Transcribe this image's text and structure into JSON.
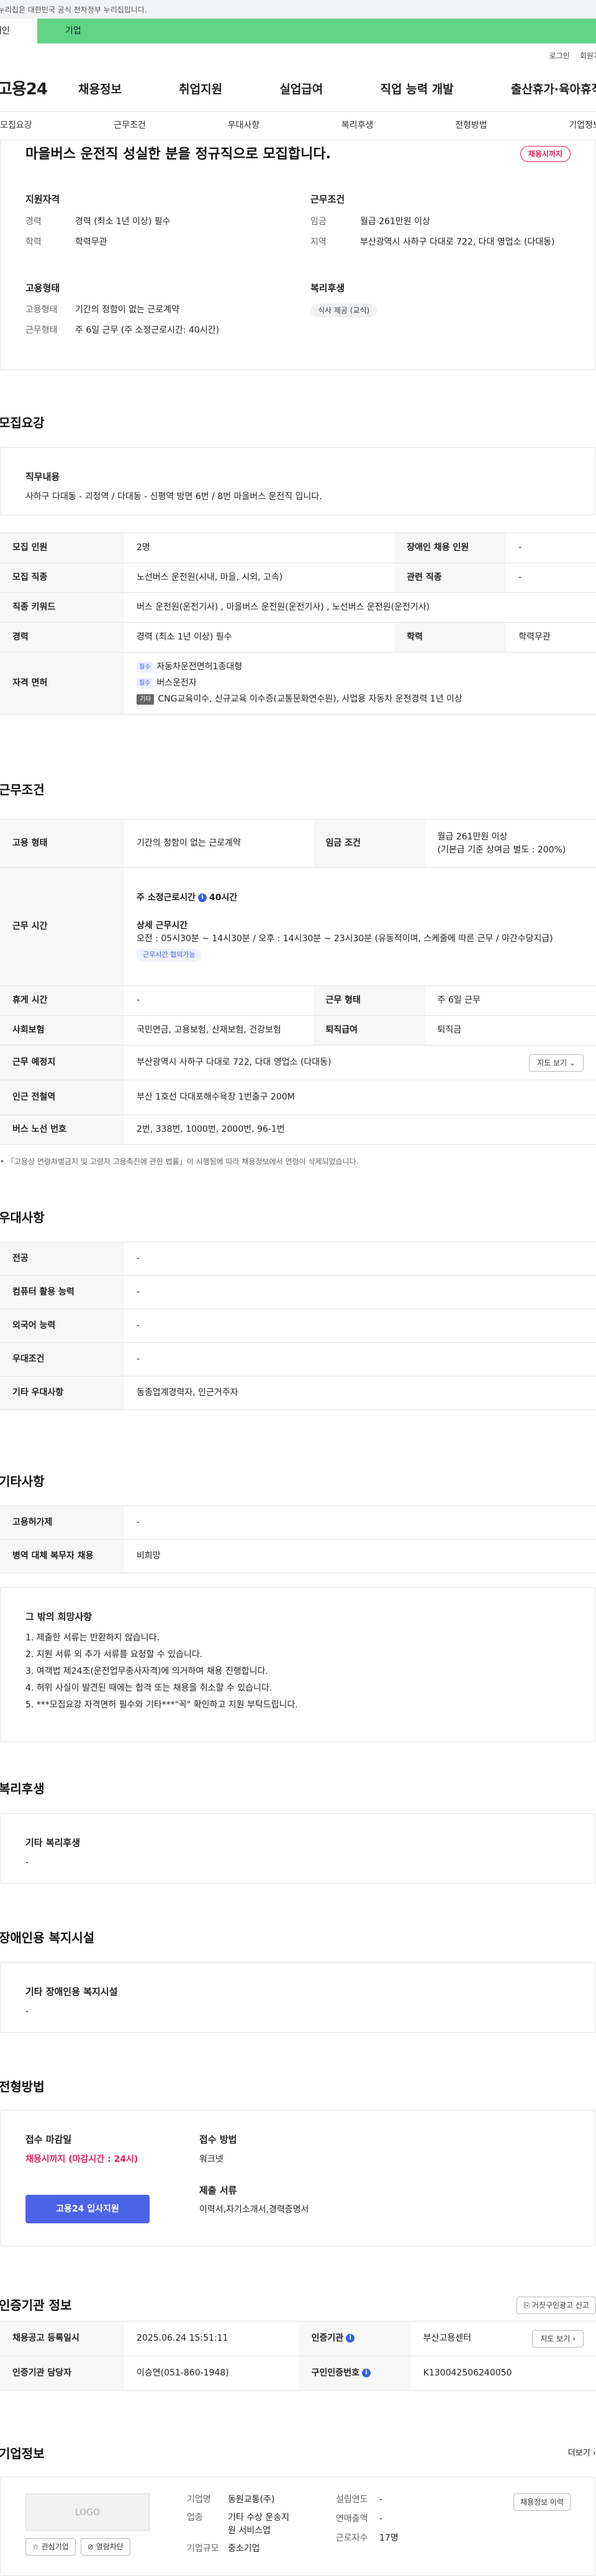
{
  "gov_banner": "이 누리집은 대한민국 공식 전자정부 누리집입니다.",
  "type_tabs": {
    "individual": "개인",
    "company": "기업"
  },
  "util": {
    "login": "로그인",
    "join": "회원가입"
  },
  "logo": "고용24",
  "gnb": [
    "채용정보",
    "취업지원",
    "실업급여",
    "직업 능력 개발",
    "출산휴가·육아휴직"
  ],
  "anchors": [
    "모집요강",
    "근무조건",
    "우대사항",
    "복리후생",
    "전형방법",
    "기업정보"
  ],
  "summary": {
    "title": "마을버스 운전직 성실한 분을 정규직으로 모집합니다.",
    "badge": "채용시까지",
    "qual_title": "지원자격",
    "career_k": "경력",
    "career_v": "경력 (최소 1년 이상) 필수",
    "edu_k": "학력",
    "edu_v": "학력무관",
    "cond_title": "근무조건",
    "wage_k": "임금",
    "wage_v": "월급 261만원 이상",
    "area_k": "지역",
    "area_v": "부산광역시 사하구 다대로 722, 다대 영업소 (다대동)",
    "emp_title": "고용형태",
    "emptype_k": "고용형태",
    "emptype_v": "기간의 정함이 없는 근로계약",
    "worktype_k": "근무형태",
    "worktype_v": "주 6일 근무 (주 소정근로시간: 40시간)",
    "welfare_title": "복리후생",
    "welfare_chip": "식사 제공 (교식)"
  },
  "recruit": {
    "title": "모집요강",
    "duty_title": "직무내용",
    "duty_text": "사하구 다대동 - 괴정역 / 다대동 - 신평역 방면 6번 / 8번 마을버스 운전직 입니다.",
    "rows": {
      "count_k": "모집 인원",
      "count_v": "2명",
      "disabled_k": "장애인 채용 인원",
      "disabled_v": "-",
      "job_k": "모집 직종",
      "job_v": "노선버스 운전원(시내, 마을, 시외, 고속)",
      "related_k": "관련 직종",
      "related_v": "-",
      "keyword_k": "직종 키워드",
      "keyword_v": "버스 운전원(운전기사) , 마을버스 운전원(운전기사) , 노선버스 운전원(운전기사)",
      "career_k": "경력",
      "career_v": "경력 (최소 1년 이상) 필수",
      "edu_k": "학력",
      "edu_v": "학력무관",
      "lic_k": "자격 면허",
      "lic_tag_req": "필수",
      "lic_tag_etc": "기타",
      "lic1": "자동차운전면허1종대형",
      "lic2": "버스운전자",
      "lic3": "CNG교육이수, 신규교육 이수증(교통문화연수원), 사업용 자동차 운전경력 1년 이상"
    }
  },
  "conditions": {
    "title": "근무조건",
    "emp_k": "고용 형태",
    "emp_v": "기간의 정함이 없는 근로계약",
    "wage_k": "임금 조건",
    "wage_v1": "월급 261만원 이상",
    "wage_v2": "(기본급 기준 상여금 별도 : 200%)",
    "time_k": "근무 시간",
    "time_week": "주 소정근로시간",
    "time_week_v": "40시간",
    "time_detail_title": "상세 근무시간",
    "time_detail": "오전 : 05시30분 ~ 14시30분  /  오후 : 14시30분 ~ 23시30분 (유동적이며, 스케줄에 따른 근무 / 야간수당지급)",
    "time_pill": "근무시간 협의가능",
    "holiday_k": "휴게 시간",
    "holiday_v": "-",
    "worktype_k": "근무 형태",
    "worktype_v": "주 6일 근무",
    "insurance_k": "사회보험",
    "insurance_v": "국민연금, 고용보험, 산재보험, 건강보험",
    "retire_k": "퇴직급여",
    "retire_v": "퇴직금",
    "place_k": "근무 예정지",
    "place_v": "부산광역시 사하구 다대로 722, 다대 영업소 (다대동)",
    "map_btn": "지도 보기",
    "subway_k": "인근 전철역",
    "subway_v": "부산 1호선 다대포해수욕장 1번출구 200M",
    "bus_k": "버스 노선 번호",
    "bus_v": "2번, 338번, 1000번, 2000번, 96-1번",
    "note": "「고용상 연령차별금지 및 고령자 고용촉진에 관한 법률」이 시행됨에 따라 채용정보에서 연령이 삭제되었습니다."
  },
  "prefer": {
    "title": "우대사항",
    "major_k": "전공",
    "major_v": "-",
    "pc_k": "컴퓨터 활용 능력",
    "pc_v": "-",
    "lang_k": "외국어 능력",
    "lang_v": "-",
    "cond_k": "우대조건",
    "cond_v": "-",
    "etc_k": "기타 우대사항",
    "etc_v": "동종업계경력자, 인근거주자"
  },
  "etc": {
    "title": "기타사항",
    "permit_k": "고용허가제",
    "permit_v": "-",
    "military_k": "병역 대체 복무자 채용",
    "military_v": "비희망",
    "other_title": "그 밖의 희망사항",
    "other_items": [
      "1. 제출한 서류는 반환하지 않습니다.",
      "2. 지원 서류 외 추가 서류를 요청할 수 있습니다.",
      "3. 여객법 제24조(운전업무종사자격)에 의거하여 채용 진행합니다.",
      "4. 허위 사실이 발견된 때에는 합격 또는 채용을 취소할 수 있습니다.",
      "5. ***모집요강 자격면허 필수와 기타***\"꼭\" 확인하고 지원 부탁드립니다."
    ]
  },
  "welfare": {
    "title": "복리후생",
    "box_title": "기타 복리후생",
    "box_v": "-"
  },
  "disabled_fac": {
    "title": "장애인용 복지시설",
    "box_title": "기타 장애인용 복지시설",
    "box_v": "-"
  },
  "selection": {
    "title": "전형방법",
    "deadline_title": "접수 마감일",
    "deadline_v": "채용시까지 (마감시간 : 24시)",
    "apply_btn": "고용24 입사지원",
    "method_title": "접수 방법",
    "method_v": "워크넷",
    "docs_title": "제출 서류",
    "docs_v": "이력서,자기소개서,경력증명서"
  },
  "cert": {
    "title": "인증기관 정보",
    "report_btn": "거짓구인광고 신고",
    "reg_k": "채용공고 등록일시",
    "reg_v": "2025.06.24 15:51:11",
    "org_k": "인증기관",
    "org_v": "부산고용센터",
    "map_btn": "지도 보기",
    "manager_k": "인증기관 담당자",
    "manager_v": "이승연(051-860-1948)",
    "num_k": "구인인증번호",
    "num_v": "K130042506240050"
  },
  "company": {
    "title": "기업정보",
    "more": "더보기",
    "logo": "LOGO",
    "fav_btn": "관심기업",
    "block_btn": "열람차단",
    "name_k": "기업명",
    "name_v": "동원교통(주)",
    "industry_k": "업종",
    "industry_v1": "기타 수상 운송지",
    "industry_v2": "원 서비스업",
    "scale_k": "기업규모",
    "scale_v": "중소기업",
    "founded_k": "설립연도",
    "founded_v": "-",
    "revenue_k": "연매출액",
    "revenue_v": "-",
    "employees_k": "근로자수",
    "employees_v": "17명",
    "history_btn": "채용정보 이력"
  }
}
